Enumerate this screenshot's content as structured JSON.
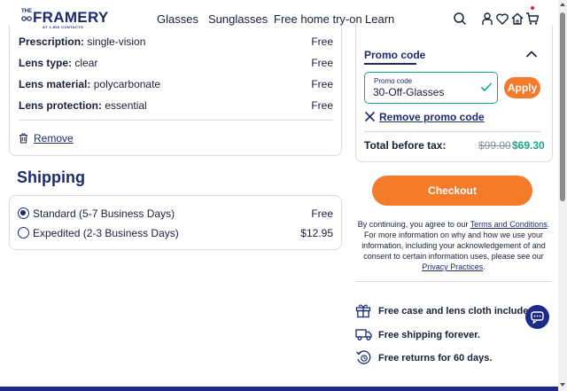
{
  "header": {
    "logo": {
      "the": "THE",
      "word": "FRAMERY",
      "sub": "AT 1-800 CONTACTS"
    },
    "nav": [
      "Glasses",
      "Sunglasses",
      "Free home try-on",
      "Learn"
    ],
    "icons": [
      "search-icon",
      "account-icon",
      "heart-icon",
      "home-icon",
      "cart-icon"
    ]
  },
  "order": {
    "rows": [
      {
        "label": "Prescription:",
        "value": "single-vision",
        "price": "Free"
      },
      {
        "label": "Lens type:",
        "value": "clear",
        "price": "Free"
      },
      {
        "label": "Lens material:",
        "value": "polycarbonate",
        "price": "Free"
      },
      {
        "label": "Lens protection:",
        "value": "essential",
        "price": "Free"
      }
    ],
    "remove_label": "Remove"
  },
  "shipping": {
    "title": "Shipping",
    "options": [
      {
        "label": "Standard (5-7 Business Days)",
        "price": "Free",
        "selected": true
      },
      {
        "label": "Expedited (2-3 Business Days)",
        "price": "$12.95",
        "selected": false
      }
    ]
  },
  "promo": {
    "title": "Promo code",
    "field_label": "Promo code",
    "field_value": "30-Off-Glasses",
    "apply_label": "Apply",
    "remove_label": "Remove promo code",
    "total_label": "Total before tax:",
    "total_old": "$99.00",
    "total_new": "$69.30"
  },
  "checkout": {
    "button_label": "Checkout",
    "legal_pre": "By continuing, you agree to our ",
    "legal_link1": "Terms and Conditions",
    "legal_mid": ". For more information on why and how we use your information, including your acknowledgement of and consent to certain information uses, please see our ",
    "legal_link2": "Privacy Practices",
    "legal_post": "."
  },
  "perks": [
    {
      "icon": "gift-icon",
      "text": "Free case and lens cloth included."
    },
    {
      "icon": "truck-icon",
      "text": "Free shipping forever."
    },
    {
      "icon": "returns-icon",
      "text": "Free returns for 60 days."
    }
  ],
  "colors": {
    "navy": "#1c2a6e",
    "orange": "#f47b2a",
    "green": "#1aa784"
  }
}
